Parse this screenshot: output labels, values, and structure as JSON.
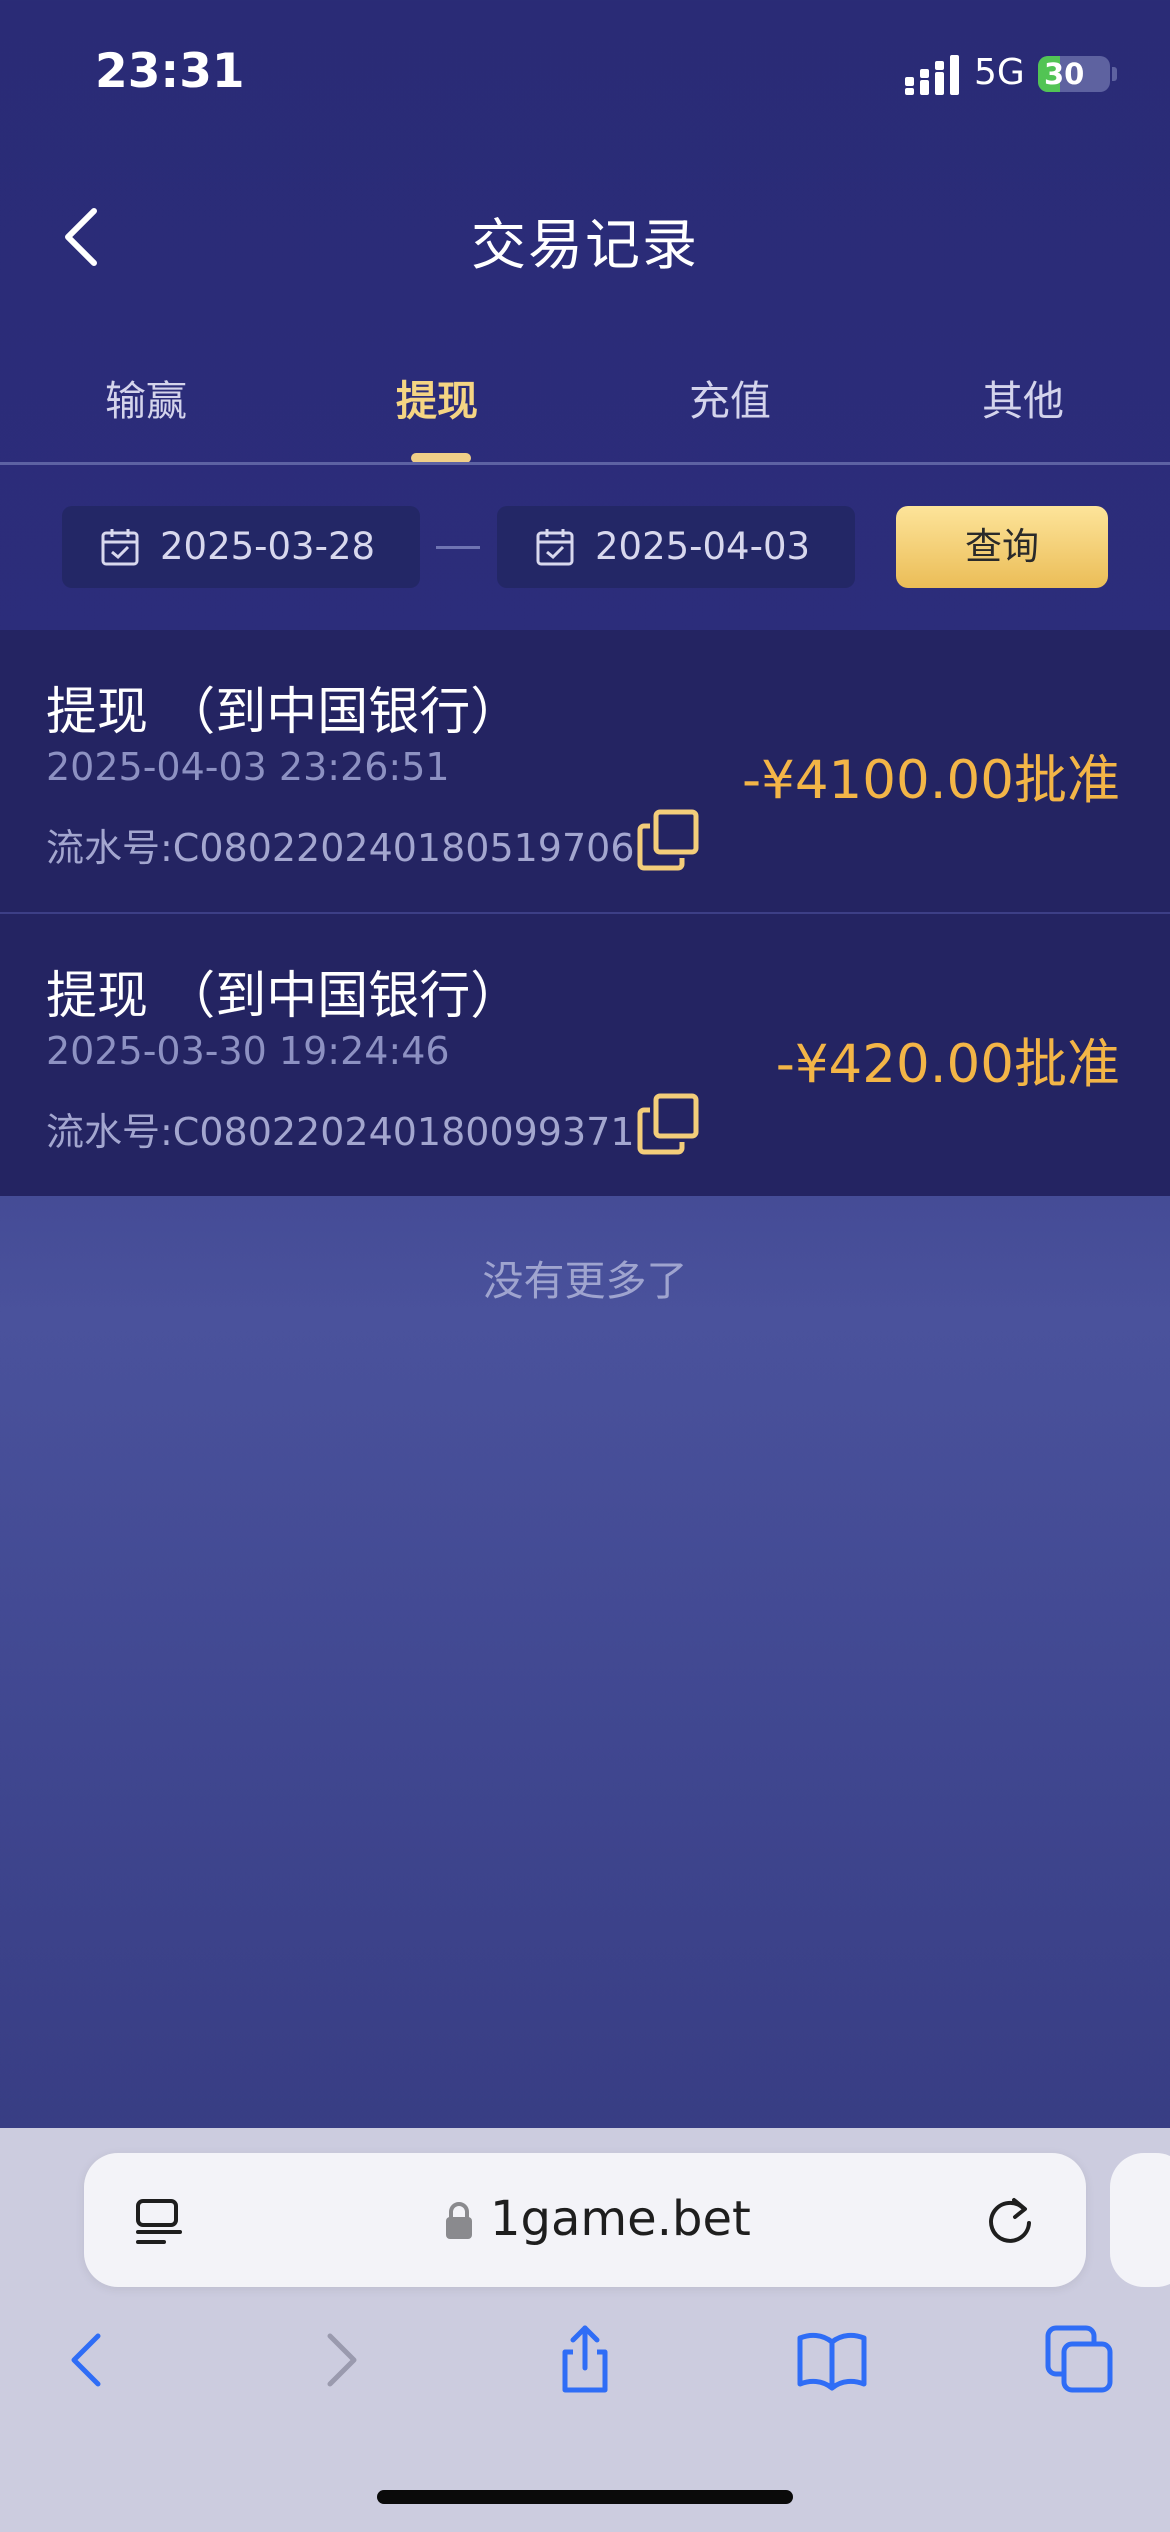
{
  "status_bar": {
    "time": "23:31",
    "network": "5G",
    "battery": "30",
    "battery_fraction": 0.3
  },
  "header": {
    "title": "交易记录",
    "back_icon": "chevron-left-icon"
  },
  "tabs": [
    {
      "label": "输赢",
      "active": false
    },
    {
      "label": "提现",
      "active": true
    },
    {
      "label": "充值",
      "active": false
    },
    {
      "label": "其他",
      "active": false
    }
  ],
  "filter": {
    "start_date": "2025-03-28",
    "end_date": "2025-04-03",
    "query_label": "查询"
  },
  "records": [
    {
      "title": "提现 （到中国银行）",
      "time": "2025-04-03 23:26:51",
      "serial": "流水号:C080220240180519706",
      "amount": "-¥4100.00批准"
    },
    {
      "title": "提现 （到中国银行）",
      "time": "2025-03-30 19:24:46",
      "serial": "流水号:C080220240180099371",
      "amount": "-¥420.00批准"
    }
  ],
  "no_more": "没有更多了",
  "browser": {
    "url": "1game.bet"
  },
  "colors": {
    "accent": "#f3b547",
    "tab_active": "#f5d583",
    "header_bg": "#2a2b76",
    "record_bg": "#242462"
  }
}
